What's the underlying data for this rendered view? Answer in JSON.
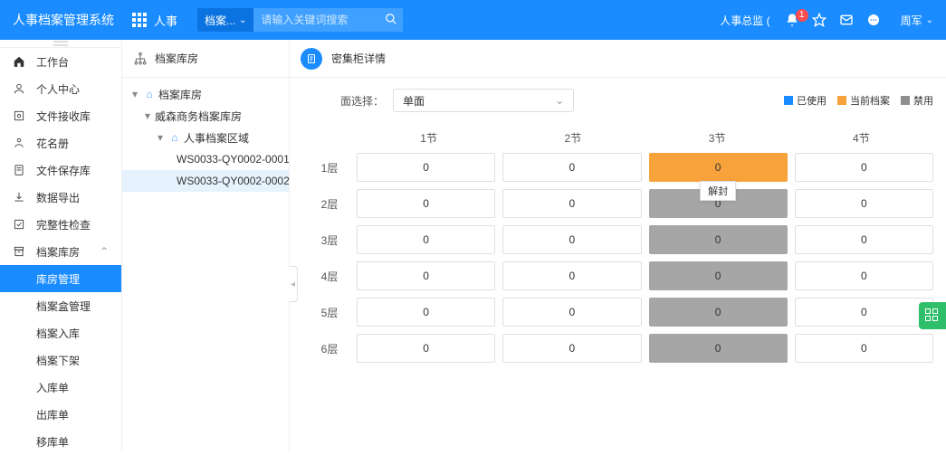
{
  "header": {
    "app_title": "人事档案管理系统",
    "module": "人事",
    "search_scope": "档案...",
    "search_placeholder": "请输入关键词搜索",
    "role_label": "人事总监 (",
    "bell_badge": "1",
    "user_name": "周军"
  },
  "sidebar": {
    "items": [
      {
        "icon": "home",
        "label": "工作台"
      },
      {
        "icon": "user",
        "label": "个人中心"
      },
      {
        "icon": "inbox",
        "label": "文件接收库"
      },
      {
        "icon": "people",
        "label": "花名册"
      },
      {
        "icon": "doc",
        "label": "文件保存库"
      },
      {
        "icon": "download",
        "label": "数据导出"
      },
      {
        "icon": "check",
        "label": "完整性检查"
      },
      {
        "icon": "archive",
        "label": "档案库房"
      }
    ],
    "subitems": [
      {
        "label": "库房管理",
        "active": true
      },
      {
        "label": "档案盒管理"
      },
      {
        "label": "档案入库"
      },
      {
        "label": "档案下架"
      },
      {
        "label": "入库单"
      },
      {
        "label": "出库单"
      },
      {
        "label": "移库单"
      }
    ]
  },
  "tree": {
    "title": "档案库房",
    "root": "档案库房",
    "level2": "威森商务档案库房",
    "level3": "人事档案区域",
    "leaves": [
      "WS0033-QY0002-0001",
      "WS0033-QY0002-0002"
    ],
    "selected_index": 1
  },
  "main": {
    "title": "密集柜详情",
    "face_label": "面选择：",
    "face_value": "单面",
    "legend": {
      "used": "已使用",
      "current": "当前档案",
      "disabled": "禁用"
    },
    "tooltip": "解封",
    "columns": [
      "1节",
      "2节",
      "3节",
      "4节"
    ],
    "rows": [
      {
        "label": "1层",
        "cells": [
          {
            "v": "0"
          },
          {
            "v": "0"
          },
          {
            "v": "0",
            "state": "current",
            "tooltip": true
          },
          {
            "v": "0"
          }
        ]
      },
      {
        "label": "2层",
        "cells": [
          {
            "v": "0"
          },
          {
            "v": "0"
          },
          {
            "v": "0",
            "state": "disabled"
          },
          {
            "v": "0"
          }
        ]
      },
      {
        "label": "3层",
        "cells": [
          {
            "v": "0"
          },
          {
            "v": "0"
          },
          {
            "v": "0",
            "state": "disabled"
          },
          {
            "v": "0"
          }
        ]
      },
      {
        "label": "4层",
        "cells": [
          {
            "v": "0"
          },
          {
            "v": "0"
          },
          {
            "v": "0",
            "state": "disabled"
          },
          {
            "v": "0"
          }
        ]
      },
      {
        "label": "5层",
        "cells": [
          {
            "v": "0"
          },
          {
            "v": "0"
          },
          {
            "v": "0",
            "state": "disabled"
          },
          {
            "v": "0"
          }
        ]
      },
      {
        "label": "6层",
        "cells": [
          {
            "v": "0"
          },
          {
            "v": "0"
          },
          {
            "v": "0",
            "state": "disabled"
          },
          {
            "v": "0"
          }
        ]
      }
    ]
  }
}
